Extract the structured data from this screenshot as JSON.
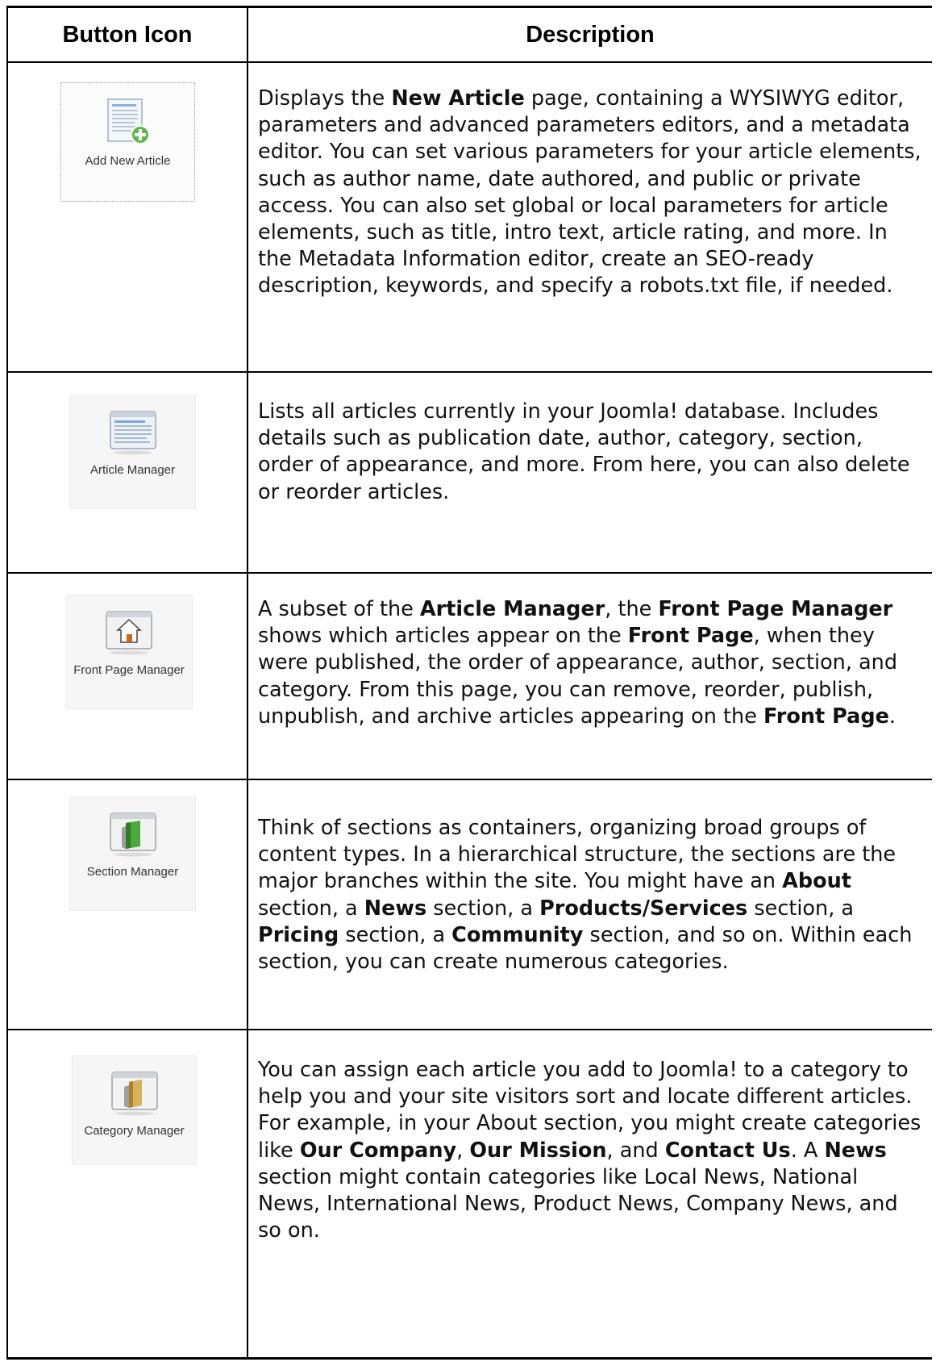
{
  "header": {
    "col1": "Button Icon",
    "col2": "Description"
  },
  "rows": [
    {
      "button_label": "Add New Article",
      "icon": "add-new-article-icon",
      "desc": [
        {
          "t": "Displays the "
        },
        {
          "b": "New Article"
        },
        {
          "t": " page, containing a WYSIWYG editor, parameters and advanced parameters editors, and a metadata editor. You can set various parameters for your article elements, such as author name, date authored, and public or private access. You can also set global or local parameters for article elements, such as title, intro text, article rating, and more. In the Metadata Information editor, create an SEO-ready description, keywords, and specify a robots.txt file, if needed."
        }
      ]
    },
    {
      "button_label": "Article Manager",
      "icon": "article-manager-icon",
      "desc": [
        {
          "t": "Lists all articles currently in your Joomla! database. Includes details such as publication date, author, category, section, order of appearance, and more. From here, you can also delete or reorder articles."
        }
      ]
    },
    {
      "button_label": "Front Page Manager",
      "icon": "front-page-manager-icon",
      "desc": [
        {
          "t": "A subset of the "
        },
        {
          "b": "Article Manager"
        },
        {
          "t": ", the "
        },
        {
          "b": "Front Page Manager"
        },
        {
          "t": " shows which articles appear on the "
        },
        {
          "b": "Front Page"
        },
        {
          "t": ", when they were published, the order of appearance, author, section, and category. From this page, you can remove, reorder, publish, unpublish, and archive articles appearing on the "
        },
        {
          "b": "Front Page"
        },
        {
          "t": "."
        }
      ]
    },
    {
      "button_label": "Section Manager",
      "icon": "section-manager-icon",
      "desc": [
        {
          "t": "Think of sections as containers, organizing broad groups of content types. In a hierarchical structure, the sections are the major branches within the site. You might have an "
        },
        {
          "b": "About"
        },
        {
          "t": " section, a "
        },
        {
          "b": "News"
        },
        {
          "t": " section, a "
        },
        {
          "b": "Products/Services"
        },
        {
          "t": " section, a "
        },
        {
          "b": "Pricing"
        },
        {
          "t": " section, a "
        },
        {
          "b": "Community"
        },
        {
          "t": " section, and so on. Within each section, you can create numerous categories."
        }
      ]
    },
    {
      "button_label": "Category Manager",
      "icon": "category-manager-icon",
      "desc": [
        {
          "t": "You can assign each article you add to Joomla! to a category to help you and your site visitors sort and locate different articles. For example, in your About section, you might create categories like "
        },
        {
          "b": "Our Company"
        },
        {
          "t": ", "
        },
        {
          "b": "Our Mission"
        },
        {
          "t": ", and "
        },
        {
          "b": "Contact Us"
        },
        {
          "t": ". A "
        },
        {
          "b": "News"
        },
        {
          "t": " section might contain categories like Local News, National News, International News, Product News, Company News, and so on."
        }
      ]
    }
  ]
}
